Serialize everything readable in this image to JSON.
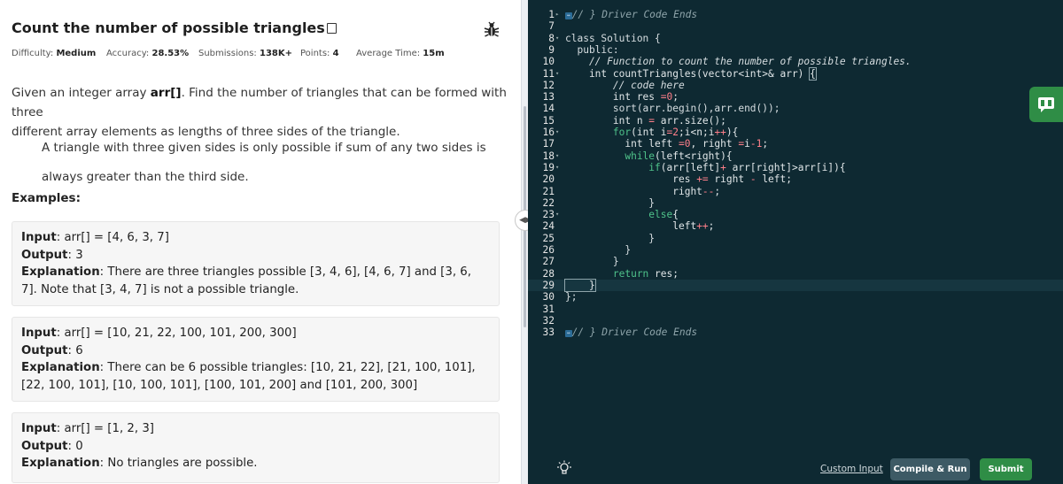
{
  "problem": {
    "title": "Count the number of possible triangles",
    "stats": [
      {
        "label": "Difficulty:",
        "value": "Medium"
      },
      {
        "label": "Accuracy:",
        "value": "28.53%"
      },
      {
        "label": "Submissions:",
        "value": "138K+"
      },
      {
        "label": "Points:",
        "value": "4"
      },
      {
        "label": "Average Time:",
        "value": "15m"
      }
    ],
    "desc1_pre": "Given an integer array ",
    "desc1_bold": "arr[]",
    "desc1_line1_rest": ". Find the number of triangles that can be formed with three",
    "desc1_line2": "different array elements as lengths of three sides of the triangle.",
    "desc2_line1": "A triangle with three given sides is only possible if sum of any two sides is",
    "desc2_line2": "always greater than the third side.",
    "examples_heading": "Examples:",
    "labels": {
      "input": "Input",
      "output": "Output",
      "explanation": "Explanation"
    },
    "examples": [
      {
        "input": "arr[]  =  [4, 6, 3, 7]",
        "output": "3",
        "explanation_l1": "There are three triangles possible [3, 4, 6], [4, 6, 7] and [3, 6,",
        "explanation_l2": "7]. Note that [3, 4, 7] is not a possible triangle."
      },
      {
        "input": "arr[]  =  [10, 21, 22, 100, 101, 200, 300]",
        "output": "6",
        "explanation_l1": "There can be 6 possible triangles: [10, 21, 22], [21, 100, 101],",
        "explanation_l2": "[22, 100, 101], [10, 100, 101], [100, 101, 200] and [101, 200, 300]"
      },
      {
        "input": "arr[]  =  [1, 2, 3]",
        "output": "0",
        "explanation_l1": "No triangles are possible.",
        "explanation_l2": ""
      }
    ]
  },
  "editor": {
    "line_numbers": [
      "1",
      "7",
      "8",
      "9",
      "10",
      "11",
      "12",
      "13",
      "14",
      "15",
      "16",
      "17",
      "18",
      "19",
      "20",
      "21",
      "22",
      "23",
      "24",
      "25",
      "26",
      "27",
      "28",
      "29",
      "30",
      "31",
      "32",
      "33"
    ],
    "fold_tag": "↔",
    "code": {
      "l1": "// } Driver Code Ends",
      "l8": "class Solution {",
      "l9": "  public:",
      "l10": "    // Function to count the number of possible triangles.",
      "l11_a": "    int countTriangles(vector<int>& arr) ",
      "l11_b": "{",
      "l12": "        // code here",
      "l13_a": "        int res ",
      "l13_b": "=",
      "l13_c": "0",
      "l13_d": ";",
      "l14": "        sort(arr.begin(),arr.end());",
      "l15_a": "        int n ",
      "l15_b": "=",
      "l15_c": " arr.size();",
      "l16_a": "        for",
      "l16_b": "(int i",
      "l16_c": "=",
      "l16_d": "2",
      "l16_e": ";i<n;i",
      "l16_f": "++",
      "l16_g": "){",
      "l17_a": "          int left ",
      "l17_b": "=",
      "l17_c": "0",
      "l17_d": ", right ",
      "l17_e": "=",
      "l17_f": "i",
      "l17_g": "-",
      "l17_h": "1",
      "l17_i": ";",
      "l18_a": "          while",
      "l18_b": "(left<right){",
      "l19_a": "              if",
      "l19_b": "(arr[left]",
      "l19_c": "+",
      "l19_d": " arr[right]>arr[i]){",
      "l20_a": "                  res ",
      "l20_b": "+=",
      "l20_c": " right ",
      "l20_d": "-",
      "l20_e": " left;",
      "l21_a": "                  right",
      "l21_b": "--",
      "l21_c": ";",
      "l22": "              }",
      "l23_a": "              else",
      "l23_b": "{",
      "l24_a": "                  left",
      "l24_b": "++",
      "l24_c": ";",
      "l25": "              }",
      "l26": "          }",
      "l27": "        }",
      "l28_a": "        return",
      "l28_b": " res;",
      "l29": "    }",
      "l30": "};",
      "l33": "// } Driver Code Ends"
    }
  },
  "footer": {
    "custom_input": "Custom Input",
    "compile_run": "Compile & Run",
    "submit": "Submit"
  }
}
